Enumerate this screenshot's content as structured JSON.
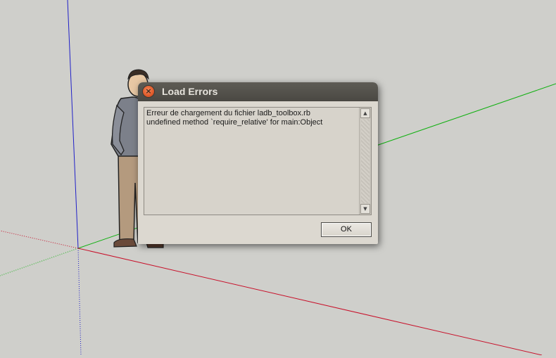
{
  "dialog": {
    "title": "Load Errors",
    "close_glyph": "×",
    "message_lines": [
      "Erreur de chargement du fichier ladb_toolbox.rb",
      "undefined method `require_relative' for main:Object"
    ],
    "ok_label": "OK",
    "scroll_up_glyph": "▲",
    "scroll_down_glyph": "▼"
  },
  "viewport": {
    "background_color": "#cfcfcb",
    "axes": {
      "blue": "#2020c8",
      "green": "#10b010",
      "red": "#c8102a"
    },
    "icons": [
      "close-icon",
      "scroll-up-arrow-icon",
      "scroll-down-arrow-icon"
    ]
  }
}
